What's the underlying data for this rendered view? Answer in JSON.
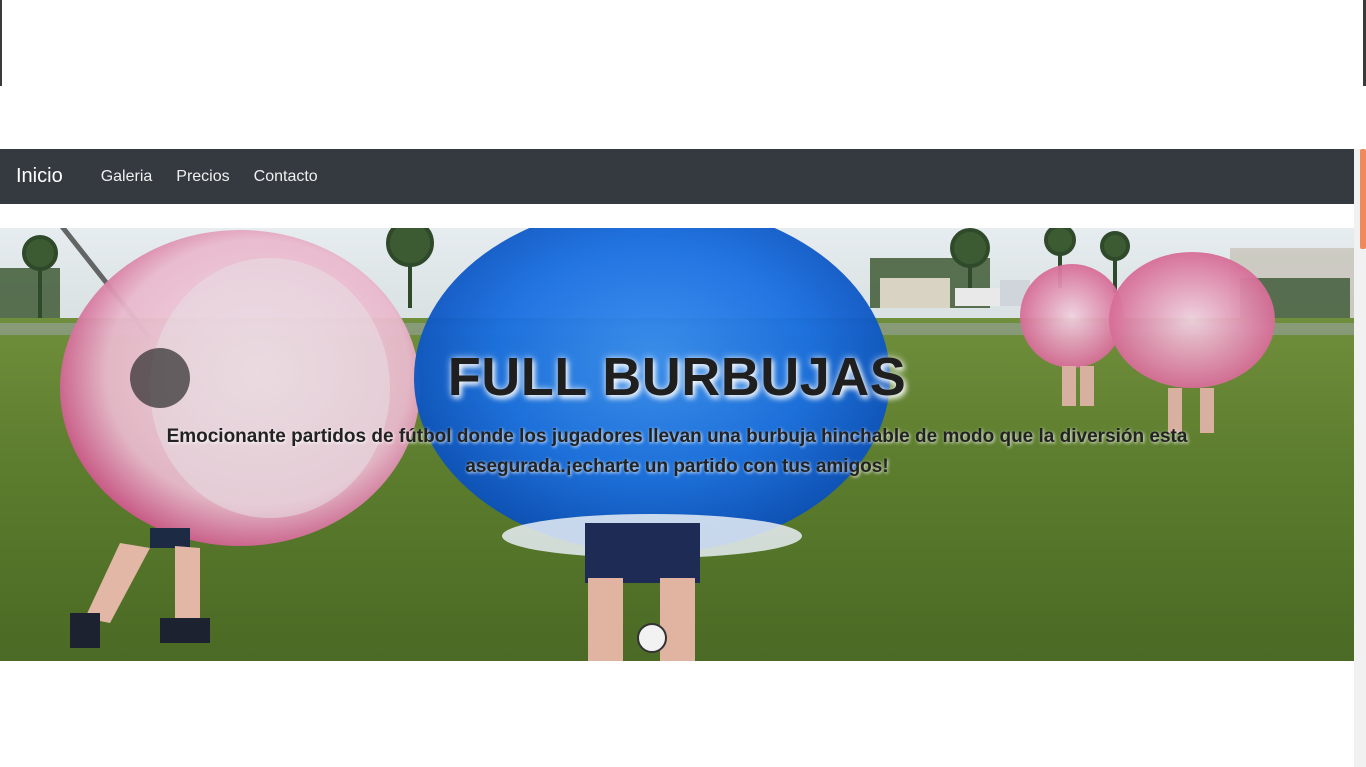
{
  "navbar": {
    "brand": "Inicio",
    "links": [
      "Galeria",
      "Precios",
      "Contacto"
    ]
  },
  "hero": {
    "title": "FULL BURBUJAS",
    "subtitle": "Emocionante partidos de fútbol donde los jugadores llevan una burbuja hinchable de modo que la diversión esta asegurada.¡echarte un partido con tus amigos!"
  },
  "colors": {
    "navbar_bg": "#343a40",
    "scroll_thumb": "#f08a5d"
  }
}
